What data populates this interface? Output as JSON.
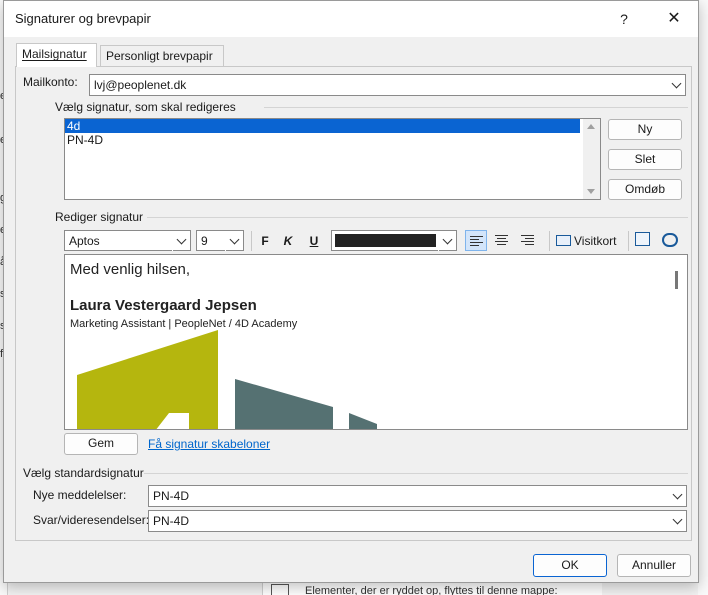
{
  "background": {
    "left_fragments": [
      "er",
      "er",
      "ge",
      "er",
      "å",
      "sl",
      "se",
      "fo"
    ],
    "bottom_text": "Elementer, der er ryddet op, flyttes til denne mappe:"
  },
  "dialog": {
    "title": "Signaturer og brevpapir",
    "help_label": "?",
    "close_label": "✕"
  },
  "tabs": [
    {
      "label": "Mailsignatur",
      "active": true
    },
    {
      "label": "Personligt brevpapir",
      "active": false
    }
  ],
  "account": {
    "label": "Mailkonto:",
    "value": "lvj@peoplenet.dk"
  },
  "select_signature": {
    "group_label": "Vælg signatur, som skal redigeres",
    "items": [
      "4d",
      "PN-4D"
    ],
    "selected_index": 0,
    "buttons": {
      "new": "Ny",
      "delete": "Slet",
      "rename": "Omdøb"
    }
  },
  "edit_signature": {
    "group_label": "Rediger signatur",
    "font": "Aptos",
    "size": "9",
    "bold": "F",
    "italic": "K",
    "underline": "U",
    "font_color": "#222222",
    "business_card": "Visitkort",
    "content": {
      "greeting": "Med venlig hilsen,",
      "name": "Laura Vestergaard Jepsen",
      "role": "Marketing Assistant  |  PeopleNet / 4D Academy"
    },
    "logo_colors": {
      "yellow": "#b5b60e",
      "teal": "#557172"
    },
    "save": "Gem",
    "templates_link": "Få signatur skabeloner"
  },
  "default_signature": {
    "group_label": "Vælg standardsignatur",
    "new_messages_label": "Nye meddelelser:",
    "new_messages_value": "PN-4D",
    "replies_label": "Svar/videresendelser:",
    "replies_value": "PN-4D"
  },
  "footer": {
    "ok": "OK",
    "cancel": "Annuller"
  }
}
